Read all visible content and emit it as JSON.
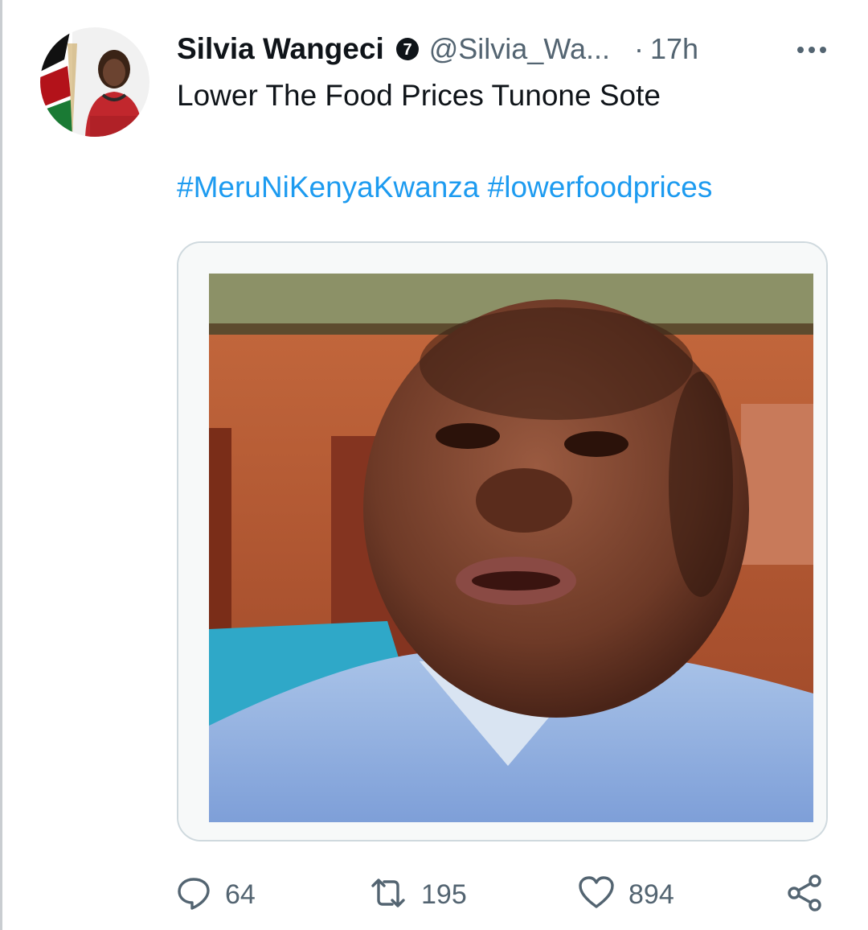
{
  "tweet": {
    "author_name": "Silvia Wangeci",
    "handle": "@Silvia_Wa...",
    "separator": "·",
    "timestamp": "17h",
    "text": "Lower The Food Prices Tunone Sote",
    "hashtags": [
      "#MeruNiKenyaKwanza",
      "#lowerfoodprices"
    ]
  },
  "actions": {
    "replies": "64",
    "retweets": "195",
    "likes": "894"
  },
  "icons": {
    "badge": "verified-badge-icon",
    "more": "more-options-icon",
    "reply": "reply-icon",
    "retweet": "retweet-icon",
    "like": "heart-icon",
    "share": "share-icon"
  },
  "colors": {
    "link": "#1d9bf0",
    "secondary_text": "#536471",
    "primary_text": "#0f1419",
    "border": "#cfd9de"
  }
}
